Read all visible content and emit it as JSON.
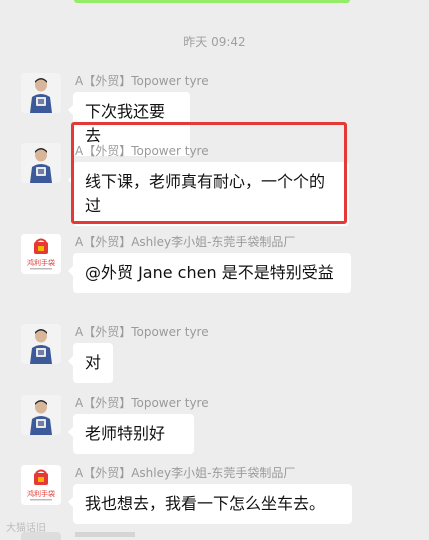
{
  "timestamp": "昨天 09:42",
  "messages": [
    {
      "sender": "A【外贸】Topower tyre",
      "text": "下次我还要去",
      "avatar": "person-avatar-icon"
    },
    {
      "sender": "A【外贸】Topower tyre",
      "text": "线下课，老师真有耐心，一个个的过",
      "avatar": "person-avatar-icon"
    },
    {
      "sender": "A【外贸】Ashley李小姐-东莞手袋制品厂",
      "text": "@外贸 Jane chen 是不是特别受益",
      "avatar": "bag-logo-icon"
    },
    {
      "sender": "A【外贸】Topower tyre",
      "text": "对",
      "avatar": "person-avatar-icon"
    },
    {
      "sender": "A【外贸】Topower tyre",
      "text": "老师特别好",
      "avatar": "person-avatar-icon"
    },
    {
      "sender": "A【外贸】Ashley李小姐-东莞手袋制品厂",
      "text": "我也想去，我看一下怎么坐车去。",
      "avatar": "bag-logo-icon"
    }
  ],
  "logo_text": "鸿利手袋",
  "watermark": "大猫话旧",
  "colors": {
    "background": "#ededed",
    "bubble": "#ffffff",
    "highlight": "#e53935",
    "logo_red": "#e53935"
  }
}
